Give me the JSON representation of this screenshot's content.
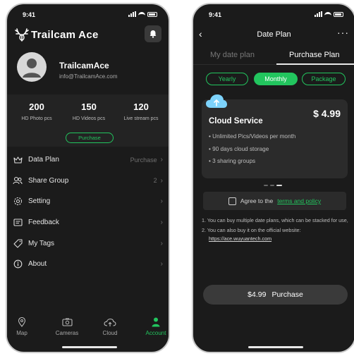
{
  "status_bar": {
    "time": "9:41"
  },
  "account": {
    "app_title": "Trailcam Ace",
    "profile": {
      "name": "TrailcamAce",
      "email": "info@TrailcamAce.com"
    },
    "stats": [
      {
        "value": "200",
        "label": "HD Photo pcs"
      },
      {
        "value": "150",
        "label": "HD Videos pcs"
      },
      {
        "value": "120",
        "label": "Live stream pcs"
      }
    ],
    "purchase_label": "Purchase",
    "menu": [
      {
        "label": "Data Plan",
        "right": "Purchase",
        "icon": "crown-icon"
      },
      {
        "label": "Share Group",
        "right": "2",
        "icon": "group-icon"
      },
      {
        "label": "Setting",
        "right": "",
        "icon": "gear-icon"
      },
      {
        "label": "Feedback",
        "right": "",
        "icon": "feedback-icon"
      },
      {
        "label": "My Tags",
        "right": "",
        "icon": "tag-icon"
      },
      {
        "label": "About",
        "right": "",
        "icon": "info-icon"
      }
    ],
    "tabs": [
      {
        "label": "Map",
        "icon": "map-pin-icon"
      },
      {
        "label": "Cameras",
        "icon": "camera-icon"
      },
      {
        "label": "Cloud",
        "icon": "cloud-upload-icon"
      },
      {
        "label": "Account",
        "icon": "user-icon",
        "active": true
      }
    ],
    "colors": {
      "accent": "#22c55e",
      "background": "#1b1b1b"
    }
  },
  "date_plan": {
    "title": "Date Plan",
    "tabs": {
      "my_plan": "My date plan",
      "purchase_plan": "Purchase Plan"
    },
    "plan_types": [
      "Yearly",
      "Monthly",
      "Package"
    ],
    "selected_plan_type": "Monthly",
    "service": {
      "name": "Cloud Service",
      "price": "$ 4.99",
      "features": [
        "Unlimited Pics/Videos per month",
        "90 days cloud storage",
        "3 sharing groups"
      ]
    },
    "agree_text": "Agree to the",
    "terms_link": "terms and policy",
    "notes": [
      "1. You can buy multiple date plans, which can be stacked for use,",
      "2. You can also buy it on the official website:"
    ],
    "website": "https://ace.wuyuantech.com",
    "buy_price": "$4.99",
    "buy_label": "Purchase"
  }
}
